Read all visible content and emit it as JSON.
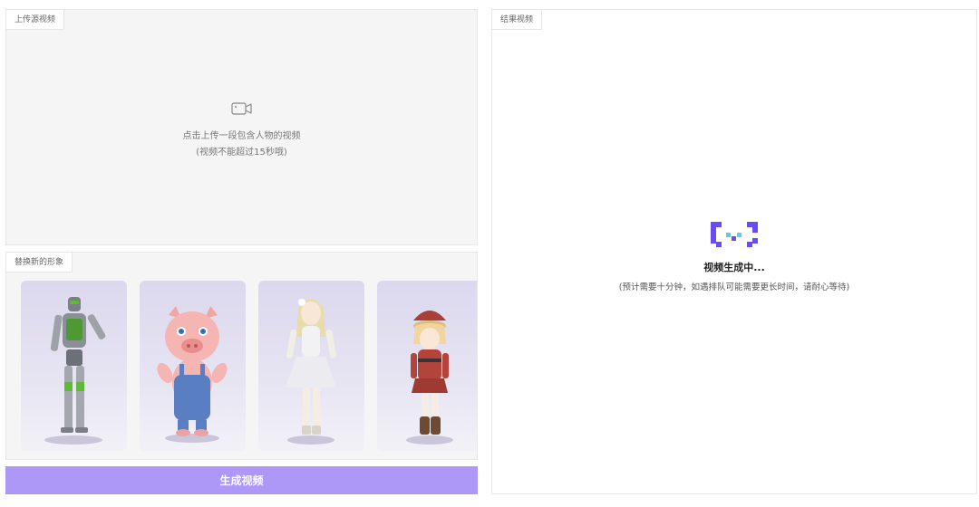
{
  "upload": {
    "tab_label": "上传源视频",
    "icon": "video-camera-icon",
    "prompt_line1": "点击上传一段包含人物的视频",
    "prompt_line2": "(视频不能超过15秒哦)"
  },
  "avatars": {
    "tab_label": "替换新的形象",
    "items": [
      {
        "name": "robot-avatar"
      },
      {
        "name": "pig-avatar"
      },
      {
        "name": "blonde-girl-avatar"
      },
      {
        "name": "red-hat-girl-avatar"
      }
    ]
  },
  "generate_button": {
    "label": "生成视频",
    "color": "#ad98f8"
  },
  "result": {
    "tab_label": "结果视频",
    "status_title": "视频生成中...",
    "status_note": "(预计需要十分钟，如遇排队可能需要更长时间，请耐心等待)",
    "loader_colors": [
      "#6a4cf5",
      "#4dd5f0"
    ]
  }
}
